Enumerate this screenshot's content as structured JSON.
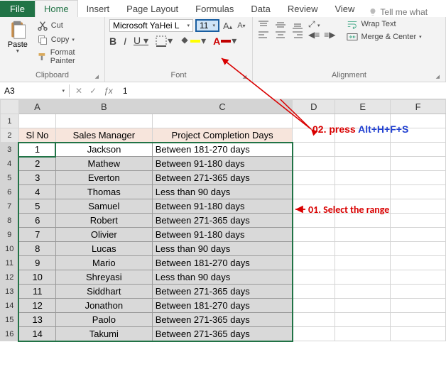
{
  "tabs": {
    "file": "File",
    "home": "Home",
    "insert": "Insert",
    "pagelayout": "Page Layout",
    "formulas": "Formulas",
    "data": "Data",
    "review": "Review",
    "view": "View",
    "tellme": "Tell me what"
  },
  "clipboard": {
    "paste": "Paste",
    "cut": "Cut",
    "copy": "Copy",
    "painter": "Format Painter",
    "label": "Clipboard"
  },
  "font": {
    "name": "Microsoft YaHei L",
    "size": "11",
    "label": "Font",
    "bold": "B",
    "italic": "I",
    "underline": "U"
  },
  "alignment": {
    "wrap": "Wrap Text",
    "merge": "Merge & Center",
    "label": "Alignment"
  },
  "namebox": "A3",
  "formula": "1",
  "cols": [
    "A",
    "B",
    "C",
    "D",
    "E",
    "F"
  ],
  "headers": {
    "a": "Sl No",
    "b": "Sales Manager",
    "c": "Project Completion Days"
  },
  "rows": [
    {
      "n": "1",
      "mgr": "Jackson",
      "proj": "Between 181-270 days"
    },
    {
      "n": "2",
      "mgr": "Mathew",
      "proj": "Between 91-180 days"
    },
    {
      "n": "3",
      "mgr": "Everton",
      "proj": "Between 271-365 days"
    },
    {
      "n": "4",
      "mgr": "Thomas",
      "proj": "Less than 90 days"
    },
    {
      "n": "5",
      "mgr": "Samuel",
      "proj": "Between 91-180 days"
    },
    {
      "n": "6",
      "mgr": "Robert",
      "proj": "Between 271-365 days"
    },
    {
      "n": "7",
      "mgr": "Olivier",
      "proj": "Between 91-180 days"
    },
    {
      "n": "8",
      "mgr": "Lucas",
      "proj": "Less than 90 days"
    },
    {
      "n": "9",
      "mgr": "Mario",
      "proj": "Between 181-270 days"
    },
    {
      "n": "10",
      "mgr": "Shreyasi",
      "proj": "Less than 90 days"
    },
    {
      "n": "11",
      "mgr": "Siddhart",
      "proj": "Between 271-365 days"
    },
    {
      "n": "12",
      "mgr": "Jonathon",
      "proj": "Between 181-270 days"
    },
    {
      "n": "13",
      "mgr": "Paolo",
      "proj": "Between 271-365 days"
    },
    {
      "n": "14",
      "mgr": "Takumi",
      "proj": "Between 271-365 days"
    }
  ],
  "anno": {
    "step1": "01. Select the range",
    "step2a": "02. press ",
    "step2b": "Alt+H+F+S"
  }
}
